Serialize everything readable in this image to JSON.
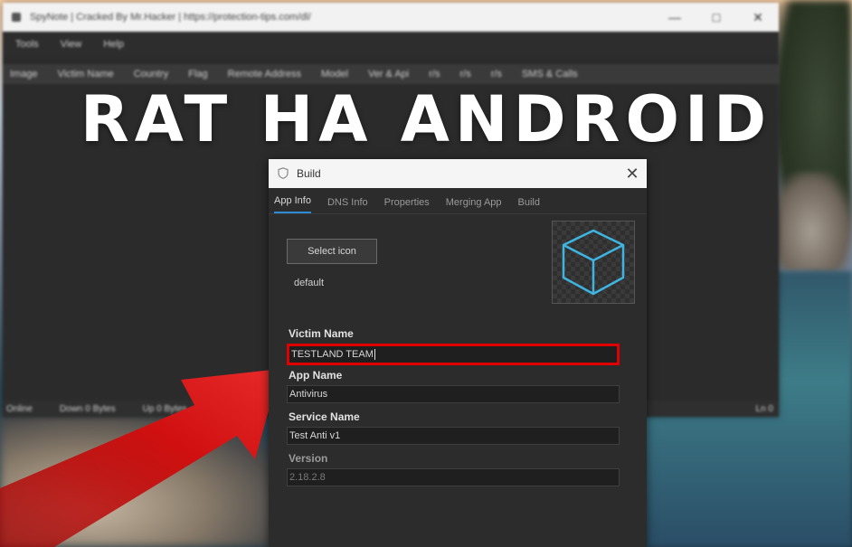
{
  "app_window": {
    "title": "SpyNote | Cracked By Mr.Hacker | https://protection-tips.com/dl/",
    "controls": [
      "—",
      "□",
      "✕"
    ],
    "menu": [
      "Tools",
      "View",
      "Help"
    ],
    "columns": [
      "Image",
      "Victim Name",
      "Country",
      "Flag",
      "Remote Address",
      "Model",
      "Ver & Api",
      "r/s",
      "r/s",
      "r/s",
      "SMS & Calls"
    ],
    "status": {
      "online": "Online",
      "down": "Down 0 Bytes",
      "up": "Up 0 Bytes",
      "ln": "Ln 0"
    }
  },
  "overlay": {
    "headline": "RAT HA ANDROID"
  },
  "dialog": {
    "title": "Build",
    "close": "✕",
    "tabs": [
      "App Info",
      "DNS Info",
      "Properties",
      "Merging App",
      "Build"
    ],
    "active_tab": "App Info",
    "select_icon_label": "Select icon",
    "icon_name": "default",
    "fields": {
      "victim_name": {
        "label": "Victim Name",
        "value": "TESTLAND TEAM"
      },
      "app_name": {
        "label": "App Name",
        "value": "Antivirus"
      },
      "service_name": {
        "label": "Service Name",
        "value": "Test Anti v1"
      },
      "version": {
        "label": "Version",
        "value": "2.18.2.8"
      }
    }
  },
  "colors": {
    "highlight_border": "#e00000",
    "active_tab_underline": "#2e8bd6",
    "cube_icon": "#3fb4e0",
    "arrow": "#d01010"
  },
  "icons": {
    "app_icon": "app-icon",
    "dialog_icon": "shield-icon",
    "cube_preview": "cube-icon"
  }
}
